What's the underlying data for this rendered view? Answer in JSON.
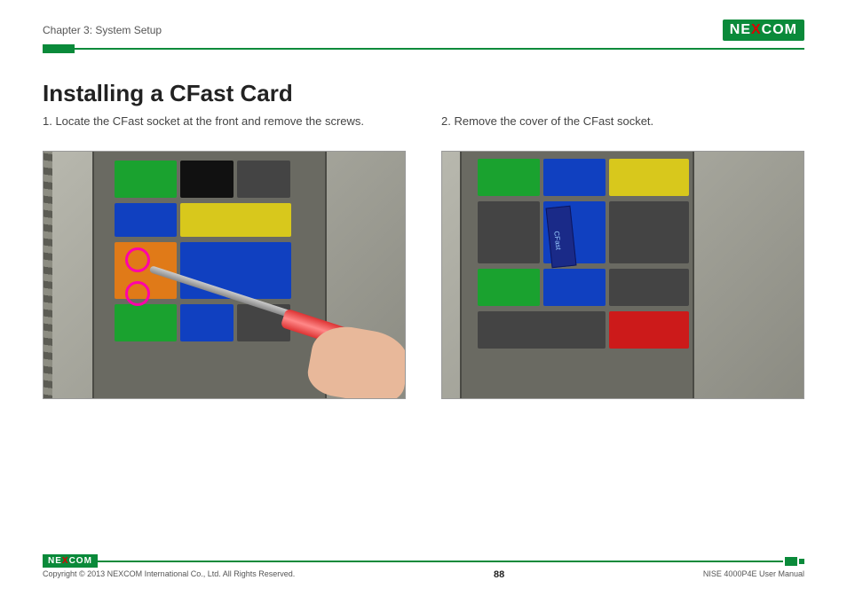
{
  "header": {
    "chapter": "Chapter 3: System Setup",
    "brand_left": "NE",
    "brand_x": "X",
    "brand_right": "COM"
  },
  "content": {
    "title": "Installing a CFast Card",
    "step1": "1. Locate the CFast socket at the front and remove the screws.",
    "step2": "2. Remove the cover of the CFast socket."
  },
  "footer": {
    "brand_left": "NE",
    "brand_x": "X",
    "brand_right": "COM",
    "copyright": "Copyright © 2013 NEXCOM International Co., Ltd. All Rights Reserved.",
    "page_number": "88",
    "doc_ref": "NISE 4000P4E User Manual"
  }
}
